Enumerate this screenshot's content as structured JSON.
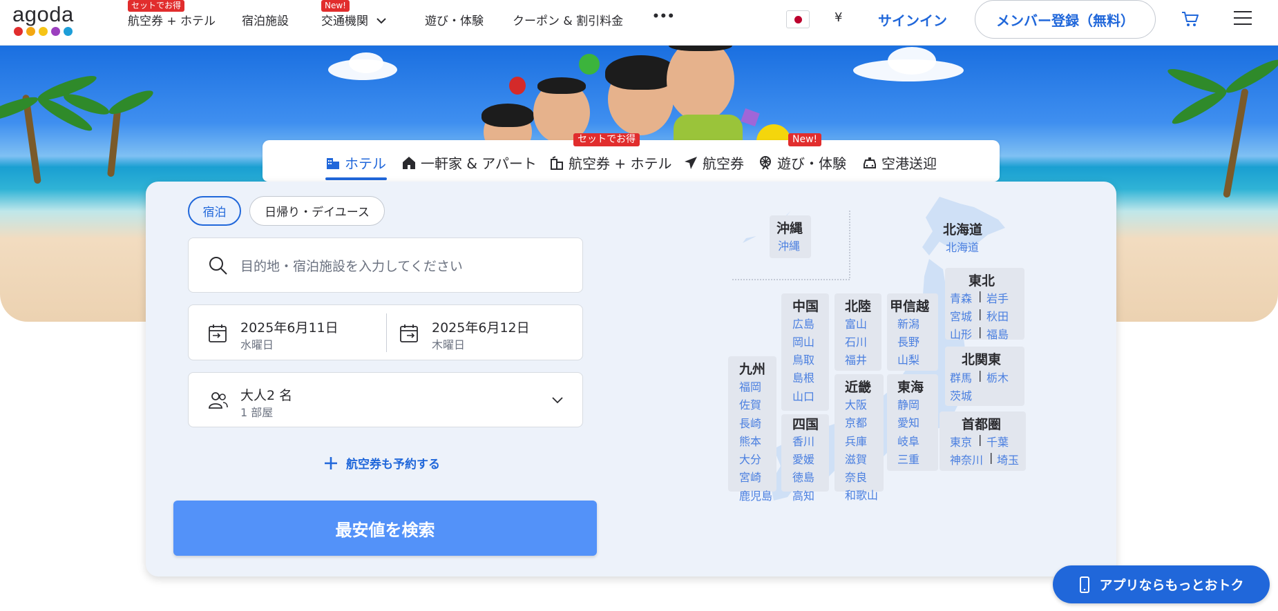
{
  "header": {
    "logo_text": "agoda",
    "logo_dot_colors": [
      "#e12d2d",
      "#f3a712",
      "#f6c416",
      "#9b3fbe",
      "#1d9ed8"
    ],
    "nav": [
      {
        "label": "航空券 + ホテル",
        "badge": "セットでお得"
      },
      {
        "label": "宿泊施設"
      },
      {
        "label": "交通機関",
        "badge": "New!"
      },
      {
        "label": "遊び・体験"
      },
      {
        "label": "クーポン & 割引料金"
      },
      {
        "label": "•••"
      }
    ],
    "currency": "¥",
    "signin": "サインイン",
    "register": "メンバー登録（無料）"
  },
  "product_tabs": {
    "items": [
      {
        "label": "ホテル",
        "icon": "hotel-icon",
        "active": true
      },
      {
        "label": "一軒家 & アパート",
        "icon": "house-icon"
      },
      {
        "label": "航空券 + ホテル",
        "icon": "building-icon",
        "badge": "セットでお得"
      },
      {
        "label": "航空券",
        "icon": "airplane-icon"
      },
      {
        "label": "遊び・体験",
        "icon": "ferris-wheel-icon",
        "badge": "New!"
      },
      {
        "label": "空港送迎",
        "icon": "car-icon"
      }
    ]
  },
  "search": {
    "stay_types": [
      "宿泊",
      "日帰り・デイユース"
    ],
    "destination_placeholder": "目的地・宿泊施設を入力してください",
    "checkin": {
      "date": "2025年6月11日",
      "weekday": "水曜日"
    },
    "checkout": {
      "date": "2025年6月12日",
      "weekday": "木曜日"
    },
    "guests": {
      "main": "大人2 名",
      "sub": "1 部屋"
    },
    "add_flight": "航空券も予約する",
    "cta": "最安値を検索"
  },
  "map": {
    "okinawa": {
      "title": "沖縄",
      "prefs": [
        "沖縄"
      ]
    },
    "hokkaido": {
      "title": "北海道",
      "prefs": [
        "北海道"
      ]
    },
    "tohoku": {
      "title": "東北",
      "prefs": [
        "青森",
        "岩手",
        "宮城",
        "秋田",
        "山形",
        "福島"
      ]
    },
    "kitakanto": {
      "title": "北関東",
      "prefs": [
        "群馬",
        "栃木",
        "茨城"
      ]
    },
    "shutoken": {
      "title": "首都圏",
      "prefs": [
        "東京",
        "千葉",
        "神奈川",
        "埼玉"
      ]
    },
    "chugoku": {
      "title": "中国",
      "prefs": [
        "広島",
        "岡山",
        "鳥取",
        "島根",
        "山口"
      ]
    },
    "hokuriku": {
      "title": "北陸",
      "prefs": [
        "富山",
        "石川",
        "福井"
      ]
    },
    "koshinetsu": {
      "title": "甲信越",
      "prefs": [
        "新潟",
        "長野",
        "山梨"
      ]
    },
    "kyushu": {
      "title": "九州",
      "prefs": [
        "福岡",
        "佐賀",
        "長崎",
        "熊本",
        "大分",
        "宮崎",
        "鹿児島"
      ]
    },
    "shikoku": {
      "title": "四国",
      "prefs": [
        "香川",
        "愛媛",
        "徳島",
        "高知"
      ]
    },
    "kinki": {
      "title": "近畿",
      "prefs": [
        "大阪",
        "京都",
        "兵庫",
        "滋賀",
        "奈良",
        "和歌山"
      ]
    },
    "tokai": {
      "title": "東海",
      "prefs": [
        "静岡",
        "愛知",
        "岐阜",
        "三重"
      ]
    }
  },
  "app_button": "アプリならもっとおトク"
}
